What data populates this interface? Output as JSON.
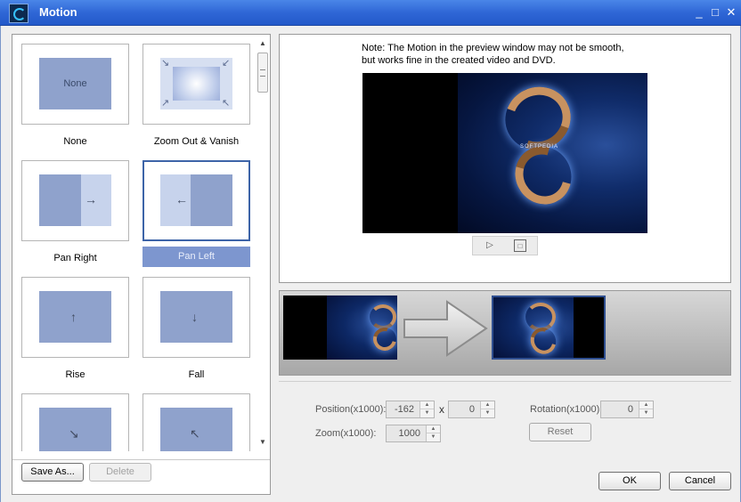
{
  "window": {
    "title": "Motion",
    "minimize_glyph": "_",
    "maximize_glyph": "□",
    "close_glyph": "✕"
  },
  "presets": [
    {
      "label": "None",
      "inner_text": "None",
      "icon": "none-preview"
    },
    {
      "label": "Zoom Out & Vanish",
      "icon": "zoom-out-vanish-preview"
    },
    {
      "label": "Pan Right",
      "icon": "right-arrow-icon"
    },
    {
      "label": "Pan Left",
      "icon": "left-arrow-icon",
      "selected": true
    },
    {
      "label": "Rise",
      "icon": "up-arrow-icon"
    },
    {
      "label": "Fall",
      "icon": "down-arrow-icon"
    },
    {
      "label": "",
      "icon": "down-right-arrow-icon"
    },
    {
      "label": "",
      "icon": "up-left-arrow-icon"
    }
  ],
  "glyphs": {
    "arrow_right": "→",
    "arrow_left": "←",
    "arrow_up": "↑",
    "arrow_down": "↓",
    "arrow_down_right": "↘",
    "arrow_up_left": "↖",
    "scroll_up": "▲",
    "scroll_down": "▼",
    "play": "▷",
    "stop": "□",
    "spin_up": "▲",
    "spin_down": "▼"
  },
  "left_buttons": {
    "save_as": "Save As...",
    "delete": "Delete"
  },
  "preview": {
    "note_line1": "Note: The Motion in the preview window may not be smooth,",
    "note_line2": "but works fine in the created video and DVD.",
    "scene_text": "SOFTPEDIA"
  },
  "params": {
    "position_label": "Position(x1000):",
    "position_x": "-162",
    "position_sep": "x",
    "position_y": "0",
    "zoom_label": "Zoom(x1000):",
    "zoom_value": "1000",
    "rotation_label": "Rotation(x1000)",
    "rotation_value": "0",
    "reset_label": "Reset"
  },
  "footer": {
    "ok_label": "OK",
    "cancel_label": "Cancel"
  },
  "colors": {
    "titlebar": "#2f67d6",
    "selected_border": "#3d64a8",
    "selected_caption": "#7d96cf",
    "tile_fill": "#8fa2cc"
  }
}
